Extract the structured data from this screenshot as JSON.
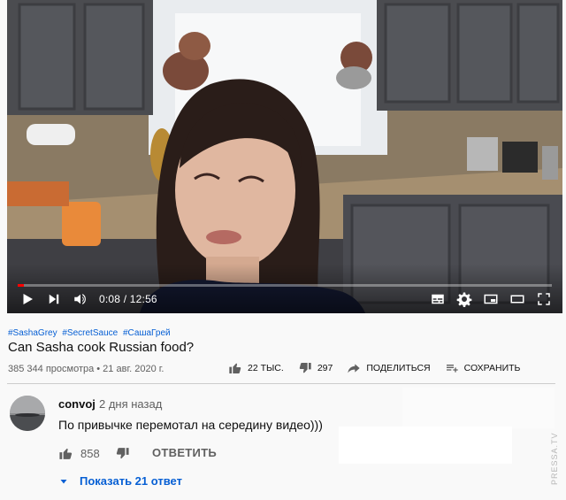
{
  "player": {
    "time_current": "0:08",
    "time_total": "12:56",
    "progress_fraction": 0.011,
    "icons": [
      "play-icon",
      "next-icon",
      "volume-icon",
      "subtitles-icon",
      "settings-icon",
      "miniplayer-icon",
      "theater-icon",
      "fullscreen-icon"
    ],
    "colors": {
      "progress": "#ff0000"
    }
  },
  "video": {
    "hashtags": [
      "#SashaGrey",
      "#SecretSauce",
      "#СашаГрей"
    ],
    "title": "Can Sasha cook Russian food?",
    "meta": "385 344 просмотра • 21 авг. 2020 г."
  },
  "actions": {
    "likes": "22 ТЫС.",
    "dislikes": "297",
    "share": "ПОДЕЛИТЬСЯ",
    "save": "СОХРАНИТЬ"
  },
  "comment": {
    "author": "convoj",
    "date": "2 дня назад",
    "text": "По привычке перемотал на середину видео)))",
    "likes": "858",
    "reply_label": "ОТВЕТИТЬ",
    "show_replies": "Показать 21 ответ"
  },
  "watermark": "PRESSA.TV",
  "colors": {
    "link": "#065fd4",
    "muted": "#606060"
  }
}
